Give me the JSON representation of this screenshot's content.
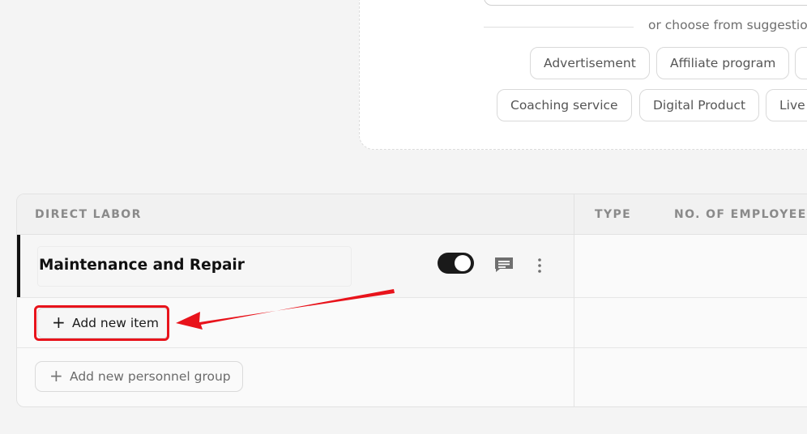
{
  "suggestions": {
    "divider_label": "or choose from suggestions",
    "chips": [
      [
        "Advertisement",
        "Affiliate program",
        ""
      ],
      [
        "Coaching service",
        "Digital Product",
        "Live"
      ]
    ]
  },
  "table": {
    "headers": {
      "direct_labor": "DIRECT LABOR",
      "type": "TYPE",
      "employees": "NO. OF EMPLOYEE"
    },
    "group": {
      "name": "Maintenance and Repair",
      "toggle_on": true
    },
    "add_item_label": "Add new item",
    "add_group_label": "Add new personnel group",
    "plus_glyph": "+"
  },
  "colors": {
    "accent_dark": "#111111",
    "annotation_red": "#e8131b",
    "muted_text": "#8a8a8a"
  },
  "icons": [
    "comment-icon",
    "more-vertical-icon",
    "plus-icon",
    "toggle-switch"
  ]
}
